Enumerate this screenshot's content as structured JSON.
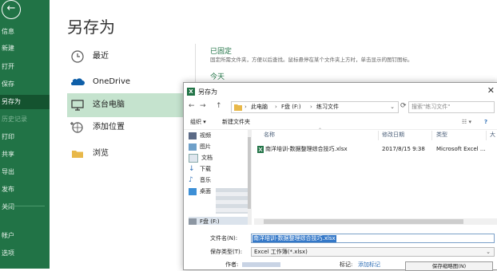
{
  "rail": {
    "back_glyph": "←",
    "items": [
      "信息",
      "新建",
      "打开",
      "保存",
      "另存为",
      "历史记录",
      "打印",
      "共享",
      "导出",
      "发布",
      "关闭",
      "帐户",
      "选项"
    ]
  },
  "backstage": {
    "title": "另存为",
    "locations": {
      "recent": "最近",
      "onedrive": "OneDrive",
      "this_pc": "这台电脑",
      "add_place": "添加位置",
      "browse": "浏览"
    },
    "pinned_heading": "已固定",
    "pinned_desc": "固定所需文件夹，方便以后查找。鼠标悬停在某个文件夹上方时，单击显示的图钉图标。",
    "today_heading": "今天"
  },
  "dialog": {
    "title": "另存为",
    "close_glyph": "✕",
    "nav_back": "←",
    "nav_forward": "→",
    "nav_up": "↑",
    "address": {
      "seg1": "此电脑",
      "seg2": "F盘 (F:)",
      "seg3": "练习文件"
    },
    "search_placeholder": "搜索\"练习文件\"",
    "toolbar": {
      "organize": "组织 ▾",
      "new_folder": "新建文件夹"
    },
    "nav_items": [
      "视频",
      "图片",
      "文档",
      "下载",
      "音乐",
      "桌面",
      "F盘 (F:)"
    ],
    "columns": {
      "name": "名称",
      "modified": "修改日期",
      "type": "类型",
      "size": "大"
    },
    "file": {
      "name": "南洋培训-数据整理综合技巧.xlsx",
      "modified": "2017/8/15 9:38",
      "type": "Microsoft Excel ..."
    },
    "filename_label": "文件名(N):",
    "filename_value": "南洋培训-数据整理综合技巧.xlsx",
    "filetype_label": "保存类型(T):",
    "filetype_value": "Excel 工作簿(*.xlsx)",
    "author_label": "作者:",
    "tags_label": "标记:",
    "tags_value": "添加标记",
    "save_thumbnail": "保存缩略图(N)"
  },
  "colors": {
    "excel_green": "#217346",
    "selection": "#c5e3ce"
  }
}
